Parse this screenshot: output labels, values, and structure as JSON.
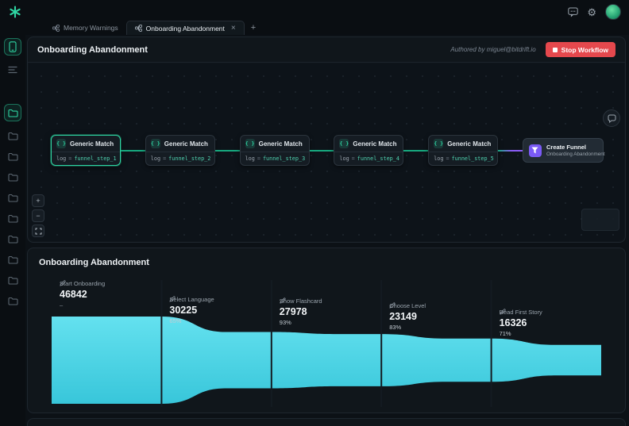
{
  "topbar": {
    "tabs": [
      {
        "label": "Memory Warnings",
        "active": false
      },
      {
        "label": "Onboarding Abandonment",
        "active": true
      }
    ],
    "new_tab_label": "+",
    "close_tab_label": "×"
  },
  "sidebar": {
    "items_top": [
      {
        "name": "device",
        "active": true
      },
      {
        "name": "list",
        "active": false
      }
    ],
    "folders": [
      {
        "active": true
      },
      {
        "active": false
      },
      {
        "active": false
      },
      {
        "active": false
      },
      {
        "active": false
      },
      {
        "active": false
      },
      {
        "active": false
      },
      {
        "active": false
      },
      {
        "active": false
      },
      {
        "active": false
      }
    ]
  },
  "workflow_header": {
    "title": "Onboarding Abandonment",
    "authored_by": "Authored by miguel@bitdrift.io",
    "stop_button": "Stop Workflow"
  },
  "workflow": {
    "nodes": [
      {
        "title": "Generic Match",
        "field": "log",
        "operator": "=",
        "value": "funnel_step_1"
      },
      {
        "title": "Generic Match",
        "field": "log",
        "operator": "=",
        "value": "funnel_step_2"
      },
      {
        "title": "Generic Match",
        "field": "log",
        "operator": "=",
        "value": "funnel_step_3"
      },
      {
        "title": "Generic Match",
        "field": "log",
        "operator": "=",
        "value": "funnel_step_4"
      },
      {
        "title": "Generic Match",
        "field": "log",
        "operator": "=",
        "value": "funnel_step_5"
      }
    ],
    "output_node": {
      "title": "Create Funnel",
      "subtitle": "Onboarding Abandonment"
    },
    "zoom_controls": [
      {
        "name": "zoom-in",
        "label": "+"
      },
      {
        "name": "zoom-out",
        "label": "−"
      },
      {
        "name": "fit-view",
        "label": "",
        "icon": "fit"
      }
    ]
  },
  "funnel_panel": {
    "title": "Onboarding Abandonment"
  },
  "chart_data": {
    "type": "area",
    "subtype": "funnel",
    "title": "Onboarding Abandonment",
    "steps": [
      {
        "label": "Start Onboarding",
        "value": 46842,
        "percent": null
      },
      {
        "label": "Select Language",
        "value": 30225,
        "percent": "65%"
      },
      {
        "label": "Show Flashcard",
        "value": 27978,
        "percent": "93%"
      },
      {
        "label": "Choose Level",
        "value": 23149,
        "percent": "83%"
      },
      {
        "label": "Read First Story",
        "value": 16326,
        "percent": "71%"
      }
    ],
    "colors": {
      "fill_top": "#64e1ef",
      "fill_bottom": "#38c6da",
      "divider": "#141b22"
    },
    "legend": "none",
    "grid": "off"
  },
  "colors": {
    "accent_green": "#2fd6a3",
    "accent_purple": "#8b5cf6",
    "danger": "#e5484d"
  }
}
